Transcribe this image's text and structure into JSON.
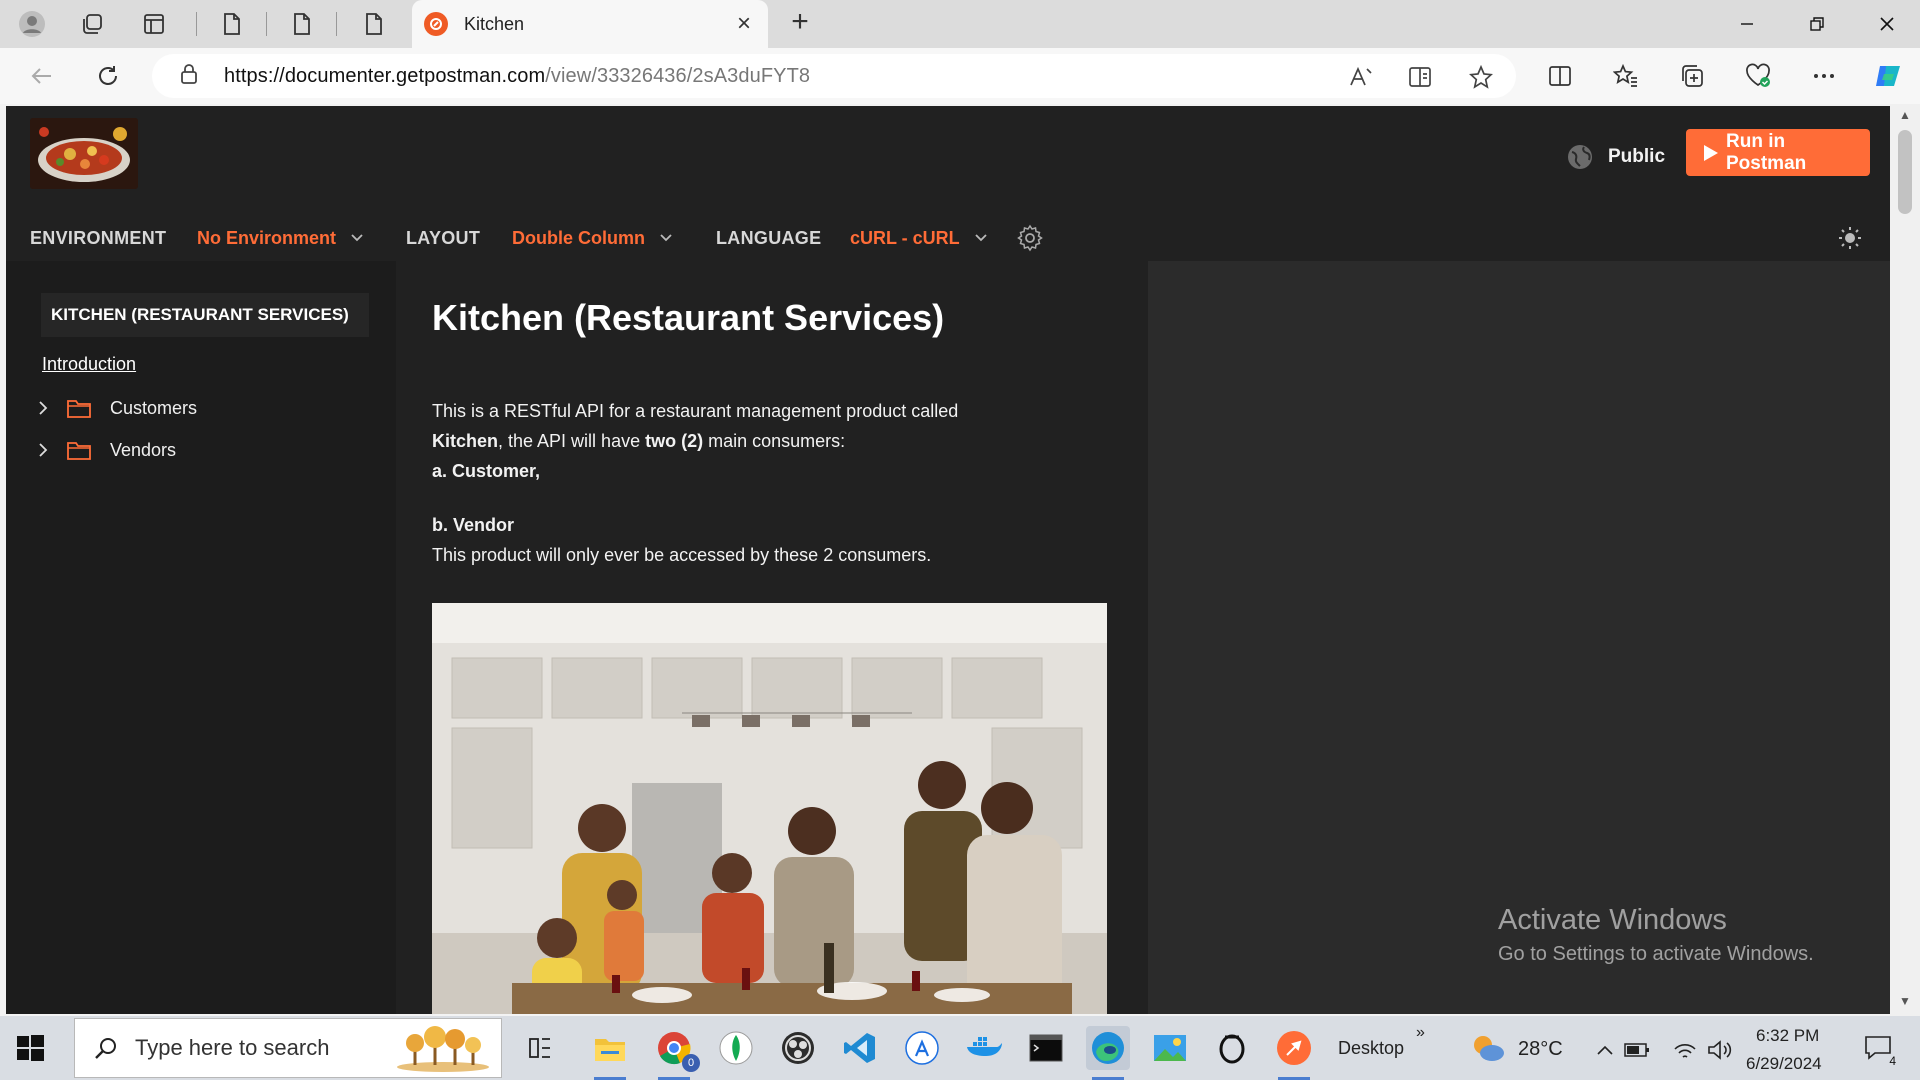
{
  "browser": {
    "tab_title": "Kitchen",
    "new_tab_symbol": "+",
    "url_host": "https://documenter.getpostman.com",
    "url_path": "/view/33326436/2sA3duFYT8"
  },
  "header": {
    "visibility_label": "Public",
    "run_button_label": "Run in Postman",
    "environment_label": "ENVIRONMENT",
    "environment_value": "No Environment",
    "layout_label": "LAYOUT",
    "layout_value": "Double Column",
    "language_label": "LANGUAGE",
    "language_value": "cURL - cURL",
    "accent_color": "#ff6c37"
  },
  "sidebar": {
    "collection_title": "KITCHEN (RESTAURANT SERVICES)",
    "intro_link": "Introduction",
    "folders": [
      {
        "label": "Customers"
      },
      {
        "label": "Vendors"
      }
    ]
  },
  "content": {
    "title": "Kitchen (Restaurant Services)",
    "line1": "This is a RESTful API for a restaurant management product called",
    "line2_bold1": "Kitchen",
    "line2_mid": ", the API will have ",
    "line2_bold2": "two (2)",
    "line2_end": " main consumers:",
    "item_a": "a. Customer,",
    "item_b": "b. Vendor",
    "line_last": "This product will only ever be accessed by these 2 consumers."
  },
  "watermark": {
    "title": "Activate Windows",
    "subtitle": "Go to Settings to activate Windows."
  },
  "taskbar": {
    "search_placeholder": "Type here to search",
    "desktop_label": "Desktop",
    "chevron_label": "»",
    "temperature": "28°C",
    "time": "6:32 PM",
    "date": "6/29/2024",
    "notification_count": "4",
    "chrome_badge": "0"
  }
}
